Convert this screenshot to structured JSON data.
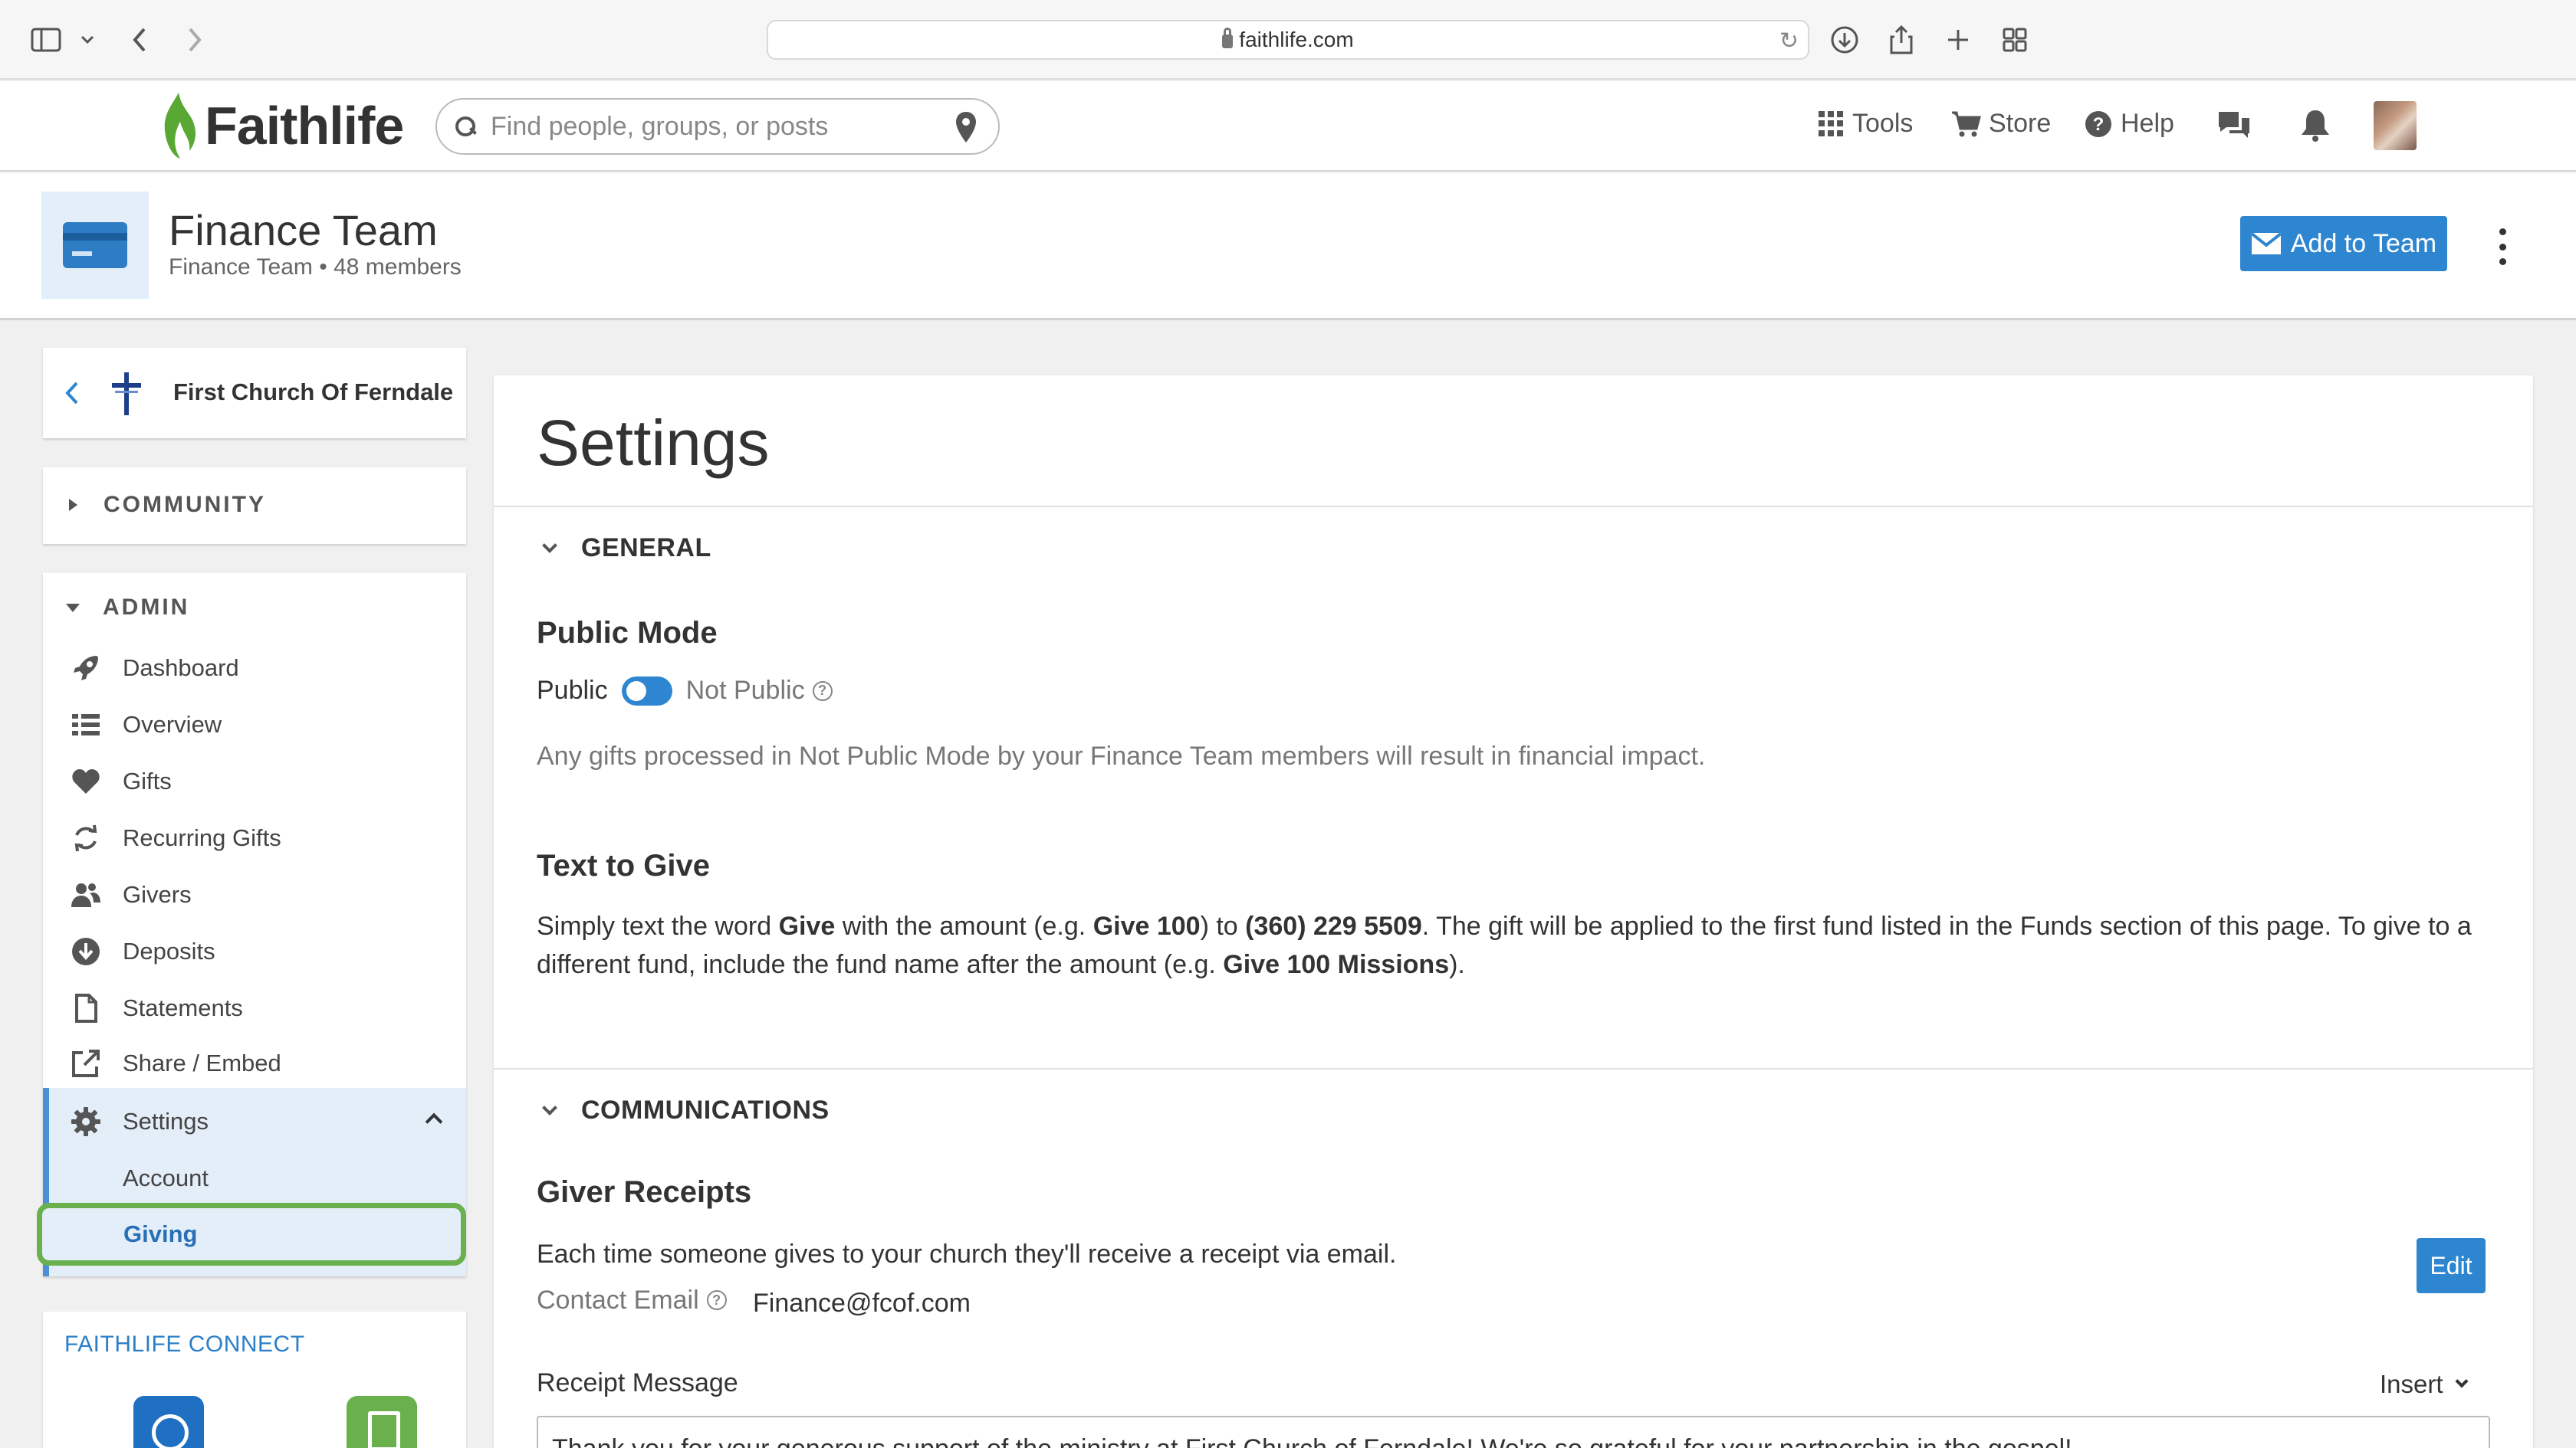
{
  "browser": {
    "url": "faithlife.com"
  },
  "site_header": {
    "logo_text": "Faithlife",
    "search_placeholder": "Find people, groups, or posts",
    "tools_label": "Tools",
    "store_label": "Store",
    "help_label": "Help"
  },
  "team": {
    "title": "Finance Team",
    "subtitle": "Finance Team",
    "member_count": "48 members",
    "add_button": "Add to Team"
  },
  "sidebar": {
    "church_name": "First Church Of Ferndale",
    "community_label": "COMMUNITY",
    "admin_label": "ADMIN",
    "items": [
      {
        "label": "Dashboard",
        "icon": "rocket-icon"
      },
      {
        "label": "Overview",
        "icon": "list-icon"
      },
      {
        "label": "Gifts",
        "icon": "heart-icon"
      },
      {
        "label": "Recurring Gifts",
        "icon": "recurring-icon"
      },
      {
        "label": "Givers",
        "icon": "people-icon"
      },
      {
        "label": "Deposits",
        "icon": "download-circle-icon"
      },
      {
        "label": "Statements",
        "icon": "document-icon"
      },
      {
        "label": "Share / Embed",
        "icon": "share-icon"
      },
      {
        "label": "Settings",
        "icon": "gear-icon"
      }
    ],
    "settings_sub": [
      {
        "label": "Account"
      },
      {
        "label": "Giving"
      }
    ],
    "connect_label": "FAITHLIFE CONNECT"
  },
  "main": {
    "title": "Settings",
    "general": {
      "label": "GENERAL",
      "public_mode_title": "Public Mode",
      "toggle_left": "Public",
      "toggle_right": "Not Public",
      "public_mode_note": "Any gifts processed in Not Public Mode by your Finance Team members will result in financial impact.",
      "text_to_give_title": "Text to Give",
      "ttg": {
        "p1": "Simply text the word ",
        "b1": "Give",
        "p2": " with the amount (e.g. ",
        "b2": "Give 100",
        "p3": ") to ",
        "b3": "(360) 229 5509",
        "p4": ". The gift will be applied to the first fund listed in the Funds section of this page. To give to a",
        "p5": "different fund, include the fund name after the amount (e.g. ",
        "b4": "Give 100 Missions",
        "p6": ")."
      }
    },
    "communications": {
      "label": "COMMUNICATIONS",
      "giver_receipts_title": "Giver Receipts",
      "giver_receipts_desc": "Each time someone gives to your church they'll receive a receipt via email.",
      "edit_button": "Edit",
      "contact_email_label": "Contact Email",
      "contact_email_value": "Finance@fcof.com",
      "receipt_message_label": "Receipt Message",
      "insert_label": "Insert",
      "receipt_message_value": "Thank you for your generous support of the ministry at First Church of Ferndale! We're so grateful for your partnership in the gospel!"
    }
  }
}
